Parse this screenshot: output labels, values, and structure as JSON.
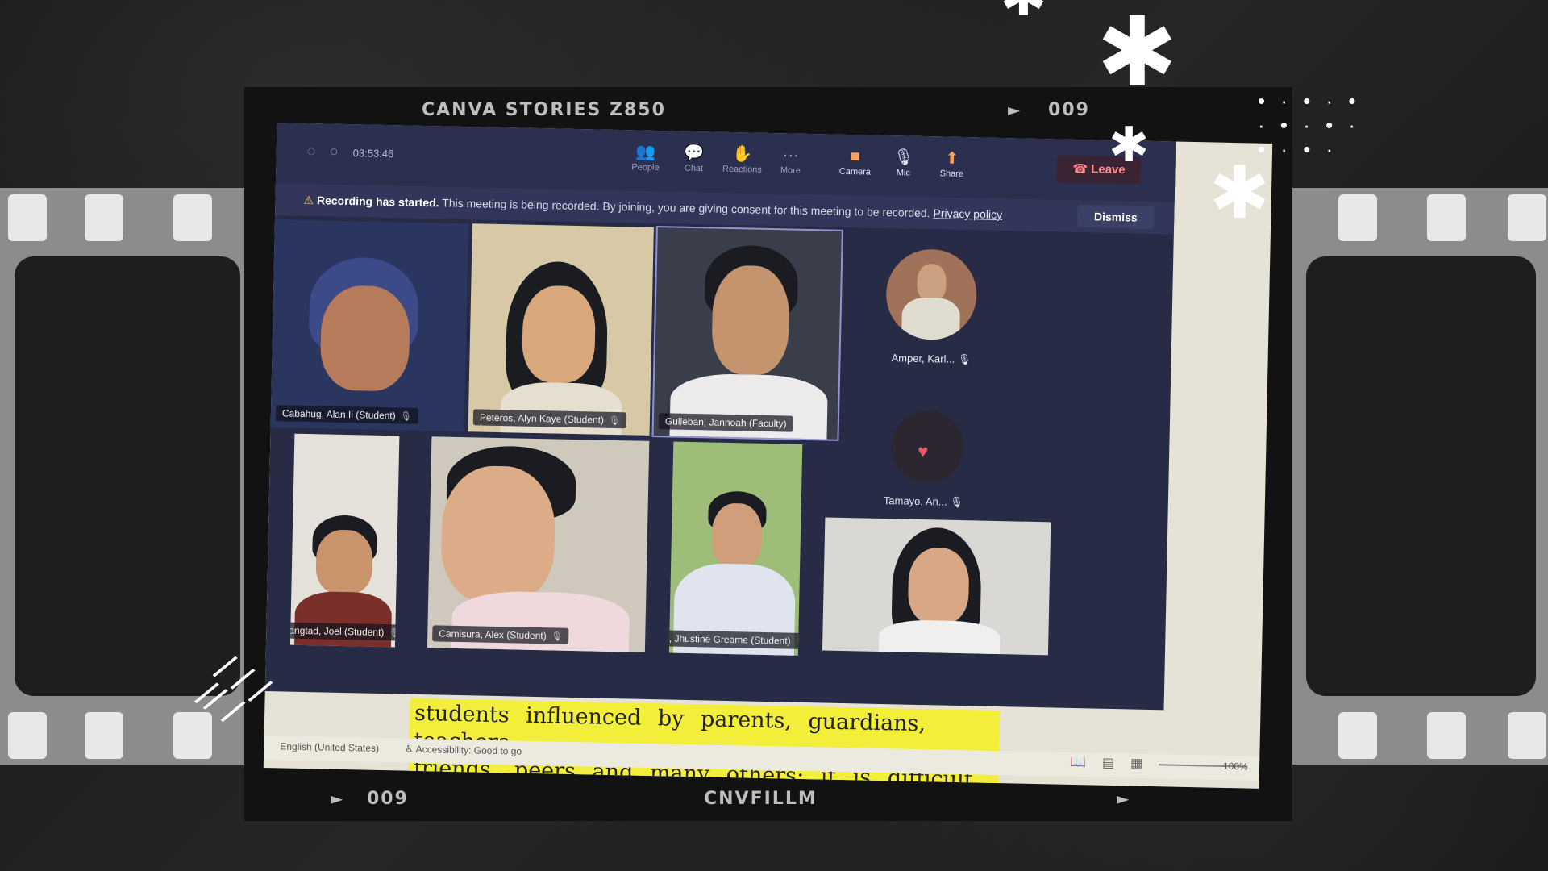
{
  "frame": {
    "top_label": "CANVA STORIES Z850",
    "top_counter": "009",
    "bottom_counter": "009",
    "bottom_label": "CNVFILLM"
  },
  "meeting": {
    "timer": "03:53:46",
    "toolbar": {
      "people": "People",
      "chat": "Chat",
      "reactions": "Reactions",
      "more": "More",
      "camera": "Camera",
      "mic": "Mic",
      "share": "Share",
      "leave": "Leave"
    },
    "banner": {
      "title": "Recording has started.",
      "message": "This meeting is being recorded. By joining, you are giving consent for this meeting to be recorded.",
      "policy_link": "Privacy policy",
      "dismiss": "Dismiss"
    },
    "participants": [
      {
        "name": "Cabahug, Alan Ii (Student)"
      },
      {
        "name": "Peteros, Alyn Kaye (Student)"
      },
      {
        "name": "Gulleban, Jannoah (Faculty)"
      },
      {
        "name": "mangtad, Joel (Student)"
      },
      {
        "name": "Camisura, Alex (Student)"
      },
      {
        "name": "Ceballos, Jhustine Greame (Student)"
      }
    ],
    "avatars": [
      {
        "name": "Amper, Karl..."
      },
      {
        "name": "Tamayo, An..."
      }
    ]
  },
  "document": {
    "line1": "students influenced by parents, guardians, teachers,",
    "line2": "friends, peers and many others; it is difficult because there",
    "language": "English (United States)",
    "accessibility": "Accessibility: Good to go",
    "zoom": "100%"
  },
  "colors": {
    "teams_bg": "#272b45",
    "leave_red": "#ff8a8a",
    "highlight": "#f3ee3a"
  }
}
